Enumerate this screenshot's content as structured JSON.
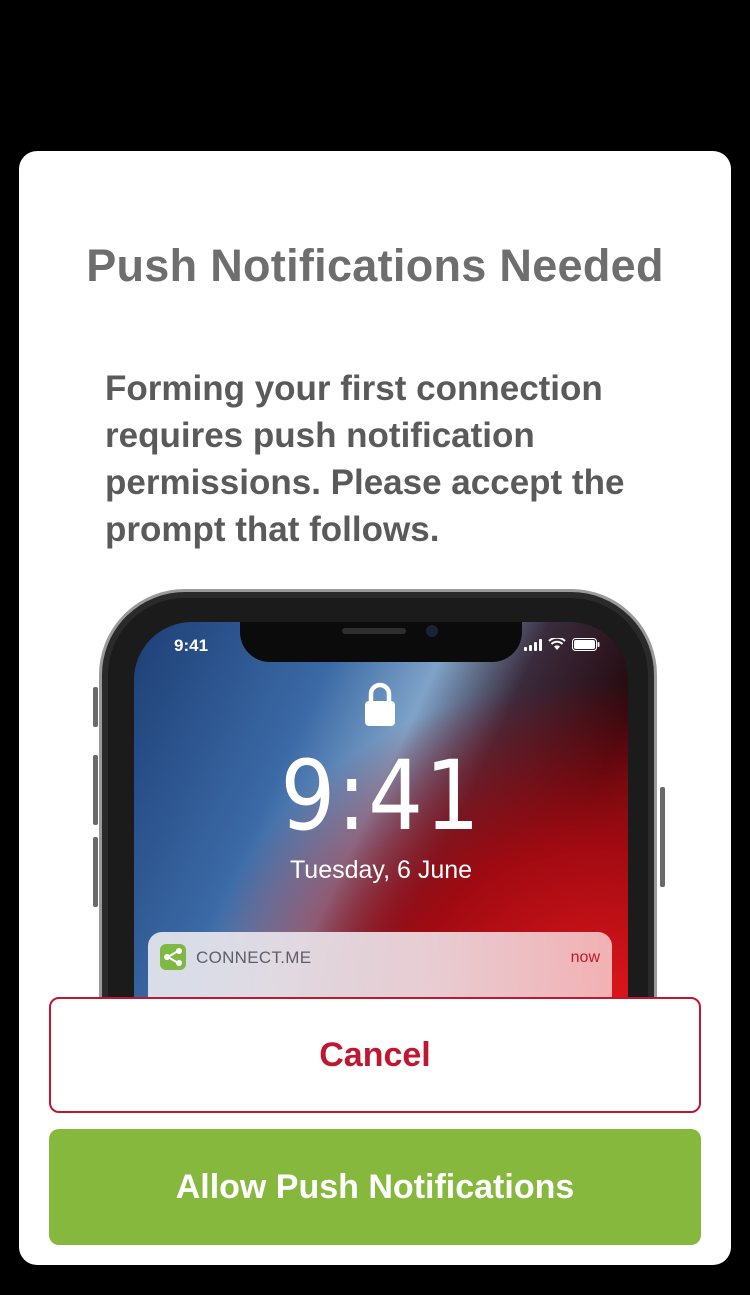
{
  "dialog": {
    "title": "Push Notifications Needed",
    "message": "Forming your first connection requires push notification permissions. Please accept the prompt that follows."
  },
  "illustration": {
    "status_time": "9:41",
    "lock_time": "9:41",
    "date": "Tuesday, 6 June",
    "notification": {
      "app_name": "CONNECT.ME",
      "time": "now",
      "icon_color": "#7fb843"
    }
  },
  "buttons": {
    "cancel_label": "Cancel",
    "allow_label": "Allow Push Notifications"
  },
  "colors": {
    "accent_red": "#c0162f",
    "accent_green": "#86b83e",
    "title_gray": "#6e6e6e"
  }
}
